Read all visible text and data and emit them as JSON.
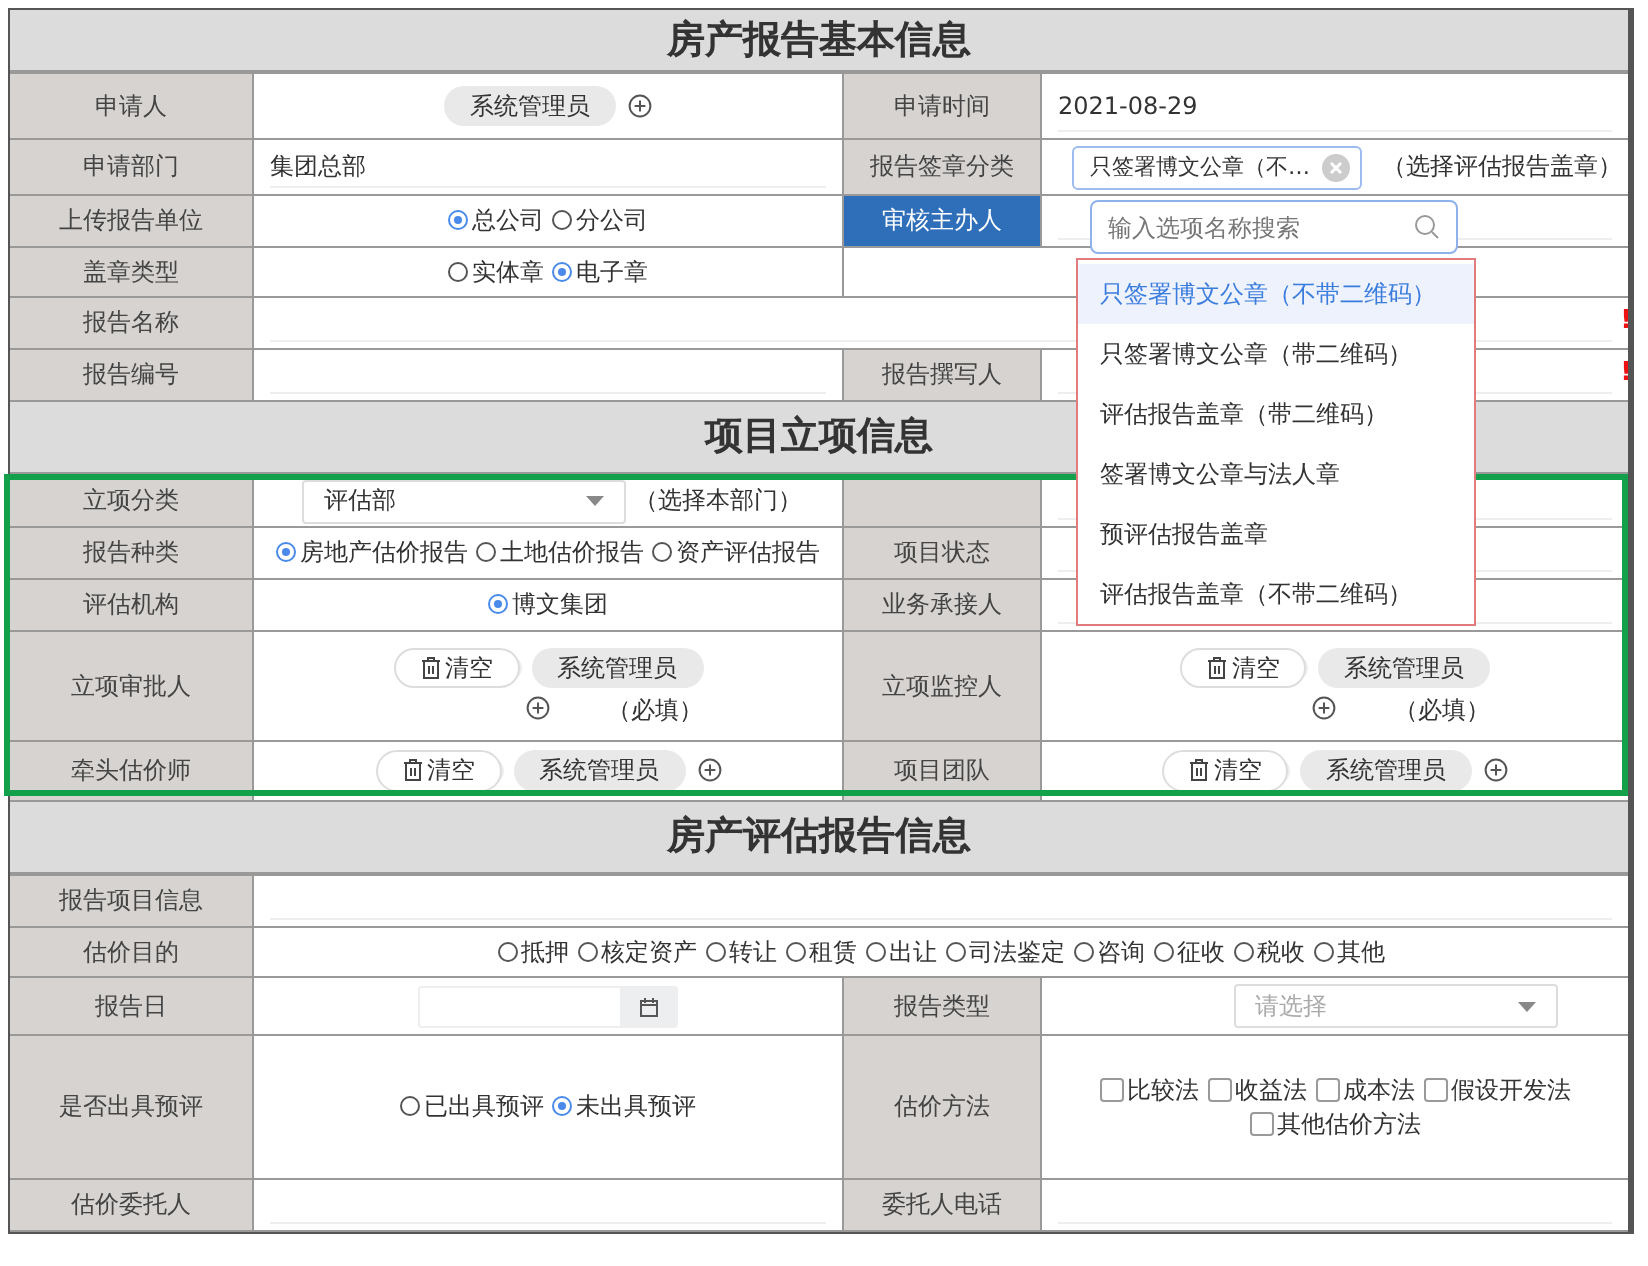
{
  "sections": [
    {
      "title": "房产报告基本信息",
      "rows": [
        {
          "fields": [
            {
              "label": "申请人",
              "highlighted": false,
              "value": {
                "kind": "people",
                "chips": [
                  "系统管理员"
                ],
                "add": true
              }
            },
            {
              "label": "申请时间",
              "highlighted": false,
              "value": {
                "kind": "text",
                "text": "2021-08-29"
              }
            }
          ]
        },
        {
          "fields": [
            {
              "label": "申请部门",
              "highlighted": false,
              "value": {
                "kind": "text",
                "text": "集团总部"
              }
            },
            {
              "label": "报告签章分类",
              "highlighted": false,
              "value": {
                "kind": "tag",
                "text": "只签署博文公章（不…",
                "note": "（选择评估报告盖章）"
              }
            }
          ]
        },
        {
          "fields": [
            {
              "label": "上传报告单位",
              "highlighted": false,
              "value": {
                "kind": "radios",
                "options": [
                  {
                    "label": "总公司",
                    "selected": true
                  },
                  {
                    "label": "分公司",
                    "selected": false
                  }
                ]
              }
            },
            {
              "label": "审核主办人",
              "highlighted": true,
              "value": {
                "kind": "input"
              }
            }
          ]
        },
        {
          "fields": [
            {
              "label": "盖章类型",
              "highlighted": false,
              "value": {
                "kind": "radios",
                "options": [
                  {
                    "label": "实体章",
                    "selected": false
                  },
                  {
                    "label": "电子章",
                    "selected": true
                  }
                ]
              }
            },
            {
              "kind": "blank"
            }
          ]
        },
        {
          "fields": [
            {
              "label": "报告名称",
              "highlighted": false,
              "value": {
                "kind": "input",
                "flag": "!"
              }
            }
          ]
        },
        {
          "fields": [
            {
              "label": "报告编号",
              "highlighted": false,
              "value": {
                "kind": "input"
              }
            },
            {
              "label": "报告撰写人",
              "highlighted": false,
              "value": {
                "kind": "input",
                "flag": "!"
              }
            }
          ]
        }
      ]
    },
    {
      "title": "项目立项信息",
      "rows": [
        {
          "fields": [
            {
              "label": "立项分类",
              "highlighted": false,
              "value": {
                "kind": "select",
                "value": "评估部",
                "note": "（选择本部门）"
              }
            },
            {
              "value": {
                "kind": "input"
              }
            }
          ]
        },
        {
          "fields": [
            {
              "label": "报告种类",
              "highlighted": false,
              "value": {
                "kind": "radios",
                "options": [
                  {
                    "label": "房地产估价报告",
                    "selected": true
                  },
                  {
                    "label": "土地估价报告",
                    "selected": false
                  },
                  {
                    "label": "资产评估报告",
                    "selected": false
                  }
                ]
              }
            },
            {
              "label": "项目状态",
              "highlighted": false,
              "value": {
                "kind": "input"
              }
            }
          ]
        },
        {
          "fields": [
            {
              "label": "评估机构",
              "highlighted": false,
              "value": {
                "kind": "radios",
                "options": [
                  {
                    "label": "博文集团",
                    "selected": true
                  }
                ]
              }
            },
            {
              "label": "业务承接人",
              "highlighted": false,
              "value": {
                "kind": "input"
              }
            }
          ]
        },
        {
          "fields": [
            {
              "label": "立项审批人",
              "highlighted": false,
              "value": {
                "kind": "people",
                "clear": "清空",
                "chips": [
                  "系统管理员"
                ],
                "add": true,
                "note": "（必填）"
              }
            },
            {
              "label": "立项监控人",
              "highlighted": false,
              "value": {
                "kind": "people",
                "clear": "清空",
                "chips": [
                  "系统管理员"
                ],
                "add": true,
                "note": "（必填）"
              }
            }
          ]
        },
        {
          "fields": [
            {
              "label": "牵头估价师",
              "highlighted": false,
              "value": {
                "kind": "people",
                "clear": "清空",
                "chips": [
                  "系统管理员"
                ],
                "add": true
              }
            },
            {
              "label": "项目团队",
              "highlighted": false,
              "value": {
                "kind": "people",
                "clear": "清空",
                "chips": [
                  "系统管理员"
                ],
                "add": true
              }
            }
          ]
        }
      ]
    },
    {
      "title": "房产评估报告信息",
      "rows": [
        {
          "fields": [
            {
              "label": "报告项目信息",
              "highlighted": false,
              "value": {
                "kind": "input"
              }
            }
          ]
        },
        {
          "fields": [
            {
              "label": "估价目的",
              "highlighted": false,
              "value": {
                "kind": "radios",
                "options": [
                  {
                    "label": "抵押",
                    "selected": false
                  },
                  {
                    "label": "核定资产",
                    "selected": false
                  },
                  {
                    "label": "转让",
                    "selected": false
                  },
                  {
                    "label": "租赁",
                    "selected": false
                  },
                  {
                    "label": "出让",
                    "selected": false
                  },
                  {
                    "label": "司法鉴定",
                    "selected": false
                  },
                  {
                    "label": "咨询",
                    "selected": false
                  },
                  {
                    "label": "征收",
                    "selected": false
                  },
                  {
                    "label": "税收",
                    "selected": false
                  },
                  {
                    "label": "其他",
                    "selected": false
                  }
                ]
              }
            }
          ]
        },
        {
          "fields": [
            {
              "label": "报告日",
              "highlighted": false,
              "value": {
                "kind": "date"
              }
            },
            {
              "label": "报告类型",
              "highlighted": false,
              "value": {
                "kind": "select",
                "placeholder": "请选择"
              }
            }
          ]
        },
        {
          "fields": [
            {
              "label": "是否出具预评",
              "highlighted": false,
              "value": {
                "kind": "radios",
                "options": [
                  {
                    "label": "已出具预评",
                    "selected": false
                  },
                  {
                    "label": "未出具预评",
                    "selected": true
                  }
                ]
              }
            },
            {
              "label": "估价方法",
              "highlighted": false,
              "value": {
                "kind": "checks",
                "options": [
                  {
                    "label": "比较法",
                    "checked": false
                  },
                  {
                    "label": "收益法",
                    "checked": false
                  },
                  {
                    "label": "成本法",
                    "checked": false
                  },
                  {
                    "label": "假设开发法",
                    "checked": false
                  },
                  {
                    "label": "其他估价方法",
                    "checked": false
                  }
                ]
              }
            }
          ]
        },
        {
          "fields": [
            {
              "label": "估价委托人",
              "highlighted": false,
              "value": {
                "kind": "input"
              }
            },
            {
              "label": "委托人电话",
              "highlighted": false,
              "value": {
                "kind": "input"
              }
            }
          ]
        }
      ]
    }
  ],
  "dropdown": {
    "placeholder": "输入选项名称搜索",
    "options": [
      {
        "label": "只签署博文公章（不带二维码）",
        "selected": true
      },
      {
        "label": "只签署博文公章（带二维码）",
        "selected": false
      },
      {
        "label": "评估报告盖章（带二维码）",
        "selected": false
      },
      {
        "label": "签署博文公章与法人章",
        "selected": false
      },
      {
        "label": "预评估报告盖章",
        "selected": false
      },
      {
        "label": "评估报告盖章（不带二维码）",
        "selected": false
      }
    ]
  }
}
